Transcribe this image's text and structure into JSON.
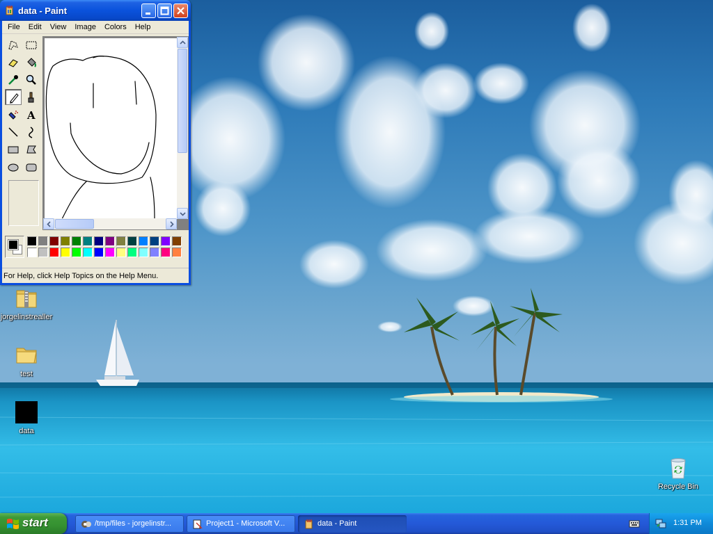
{
  "paint_window": {
    "title": "data - Paint",
    "menu": [
      "File",
      "Edit",
      "View",
      "Image",
      "Colors",
      "Help"
    ],
    "status_text": "For Help, click Help Topics on the Help Menu.",
    "selected_tool": "pencil",
    "tools": [
      "free-form-select",
      "select",
      "eraser",
      "fill-with-color",
      "pick-color",
      "magnifier",
      "pencil",
      "brush",
      "airbrush",
      "text",
      "line",
      "curve",
      "rectangle",
      "polygon",
      "ellipse",
      "rounded-rectangle"
    ],
    "foreground_color": "#000000",
    "background_color": "#ffffff",
    "palette_row1": [
      "#000000",
      "#808080",
      "#800000",
      "#808000",
      "#008000",
      "#008080",
      "#000080",
      "#800080",
      "#808040",
      "#004040",
      "#0080ff",
      "#004080",
      "#8000ff",
      "#804000"
    ],
    "palette_row2": [
      "#ffffff",
      "#c0c0c0",
      "#ff0000",
      "#ffff00",
      "#00ff00",
      "#00ffff",
      "#0000ff",
      "#ff00ff",
      "#ffff80",
      "#00ff80",
      "#80ffff",
      "#8080ff",
      "#ff0080",
      "#ff8040"
    ]
  },
  "desktop_icons": [
    {
      "label": "jorgelinstrealler",
      "icon": "zip-folder-icon"
    },
    {
      "label": "test",
      "icon": "folder-icon"
    },
    {
      "label": "data",
      "icon": "image-file-icon"
    },
    {
      "label": "Recycle Bin",
      "icon": "recycle-bin-icon"
    }
  ],
  "taskbar": {
    "start_label": "start",
    "tasks": [
      {
        "label": "/tmp/files - jorgelinstr...",
        "icon": "explorer-icon"
      },
      {
        "label": "Project1 - Microsoft V...",
        "icon": "vb-icon"
      },
      {
        "label": "data - Paint",
        "icon": "paint-icon",
        "active": true
      }
    ],
    "clock": "1:31 PM"
  }
}
